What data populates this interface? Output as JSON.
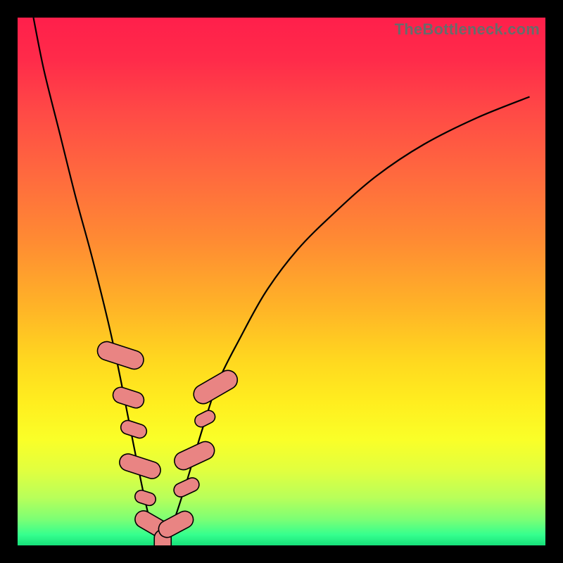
{
  "watermark": "TheBottleneck.com",
  "colors": {
    "frame": "#000000",
    "curve": "#000000",
    "bead_fill": "#e98483",
    "bead_stroke": "#000000"
  },
  "chart_data": {
    "type": "line",
    "title": "",
    "xlabel": "",
    "ylabel": "",
    "xlim": [
      0,
      100
    ],
    "ylim": [
      0,
      100
    ],
    "grid": false,
    "series": [
      {
        "name": "bottleneck-curve",
        "x": [
          3,
          5,
          8,
          11,
          14,
          17,
          19,
          21,
          23,
          25,
          27,
          29,
          32,
          35,
          38,
          42,
          47,
          53,
          60,
          68,
          77,
          87,
          97
        ],
        "y": [
          100,
          90,
          78,
          66,
          55,
          43,
          34,
          24,
          14,
          5,
          0,
          3,
          12,
          22,
          31,
          39,
          48,
          56,
          63,
          70,
          76,
          81,
          85
        ]
      }
    ],
    "markers": {
      "name": "beads",
      "shape": "rounded-rect",
      "points": [
        {
          "x": 19.5,
          "y": 36,
          "w": 3.5,
          "h": 9,
          "angle": -72
        },
        {
          "x": 21.0,
          "y": 28,
          "w": 3.0,
          "h": 6,
          "angle": -72
        },
        {
          "x": 22.0,
          "y": 22,
          "w": 2.6,
          "h": 5,
          "angle": -72
        },
        {
          "x": 23.2,
          "y": 15,
          "w": 3.2,
          "h": 8,
          "angle": -72
        },
        {
          "x": 24.2,
          "y": 9,
          "w": 2.4,
          "h": 4,
          "angle": -72
        },
        {
          "x": 25.5,
          "y": 4,
          "w": 3.2,
          "h": 7,
          "angle": -60
        },
        {
          "x": 27.5,
          "y": 0.5,
          "w": 3.2,
          "h": 5,
          "angle": 0
        },
        {
          "x": 30.0,
          "y": 4,
          "w": 3.2,
          "h": 7,
          "angle": 62
        },
        {
          "x": 32.0,
          "y": 11,
          "w": 2.6,
          "h": 5,
          "angle": 65
        },
        {
          "x": 33.5,
          "y": 17,
          "w": 3.4,
          "h": 8,
          "angle": 65
        },
        {
          "x": 35.5,
          "y": 24,
          "w": 2.4,
          "h": 4,
          "angle": 63
        },
        {
          "x": 37.5,
          "y": 30,
          "w": 3.6,
          "h": 9,
          "angle": 60
        }
      ]
    }
  }
}
